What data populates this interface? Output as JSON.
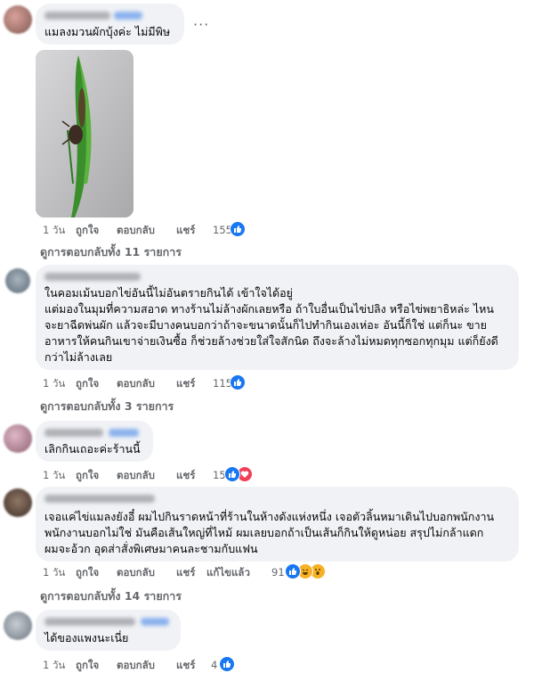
{
  "comments": [
    {
      "lines": [
        "แมลงมวนผักบุ้งค่ะ ไม่มีพิษ"
      ],
      "actions": {
        "time": "1 วัน",
        "like": "ถูกใจ",
        "reply": "ตอบกลับ",
        "share": "แชร์"
      },
      "reaction_count": "155",
      "reactions": [
        "like-icon"
      ],
      "view_replies": "ดูการตอบกลับทั้ง 11 รายการ",
      "has_photo": true,
      "more": "···"
    },
    {
      "lines": [
        "ในคอมเม้นบอกไข่อันนี้ไม่อันตรายกินได้ เข้าใจได้อยู่",
        "แต่มองในมุมที่ความสอาด ทางร้านไม่ล้างผักเลยหรือ ถ้าใบอื่นเป็นไข่ปลิง หรือไข่พยาธิหล่ะ ไหน",
        "จะยาฉีดพ่นผัก แล้วจะมีบางคนบอกว่าถ้าจะขนาดนั้นก็ไปทำกินเองเห่อะ อันนี้ก็ใช่ แต่ก็นะ ขาย",
        "อาหารให้คนกินเขาจ่ายเงินซื้อ ก็ช่วยล้างช่วยใส่ใจสักนิด ถึงจะล้างไม่หมดทุกซอกทุกมุม แต่ก็ยังดี",
        "กว่าไม่ล้างเลย"
      ],
      "actions": {
        "time": "1 วัน",
        "like": "ถูกใจ",
        "reply": "ตอบกลับ",
        "share": "แชร์"
      },
      "reaction_count": "115",
      "reactions": [
        "like-icon"
      ],
      "view_replies": "ดูการตอบกลับทั้ง 3 รายการ"
    },
    {
      "lines": [
        "เลิกกินเถอะค่ะร้านนี้"
      ],
      "actions": {
        "time": "1 วัน",
        "like": "ถูกใจ",
        "reply": "ตอบกลับ",
        "share": "แชร์"
      },
      "reaction_count": "15",
      "reactions": [
        "like-icon",
        "love-icon"
      ]
    },
    {
      "lines": [
        "เจอแค่ไข่แมลงยังอี๋ ผมไปกินราดหน้าที่ร้านในห้างดังแห่งหนึ่ง เจอตัวลิ้นหมาเดินไปบอกพนักงาน",
        "พนักงานบอกไม่ใช่ มันคือเส้นใหญ่ที่ไหม้ ผมเลยบอกถ้าเป็นเส้นก็กินให้ดูหน่อย สรุปไม่กล้าแดก",
        "ผมจะอ้วก อุดส่าสั่งพิเศษมาคนละชามกับแฟน"
      ],
      "actions": {
        "time": "1 วัน",
        "like": "ถูกใจ",
        "reply": "ตอบกลับ",
        "share": "แชร์",
        "edited": "แก้ไขแล้ว"
      },
      "reaction_count": "91",
      "reactions": [
        "like-icon",
        "haha-icon",
        "wow-icon"
      ],
      "view_replies": "ดูการตอบกลับทั้ง 14 รายการ"
    },
    {
      "lines": [
        "ได้ของแพงนะเนี่ย"
      ],
      "actions": {
        "time": "1 วัน",
        "like": "ถูกใจ",
        "reply": "ตอบกลับ",
        "share": "แชร์"
      },
      "reaction_count": "4",
      "reactions": [
        "like-icon"
      ]
    }
  ]
}
